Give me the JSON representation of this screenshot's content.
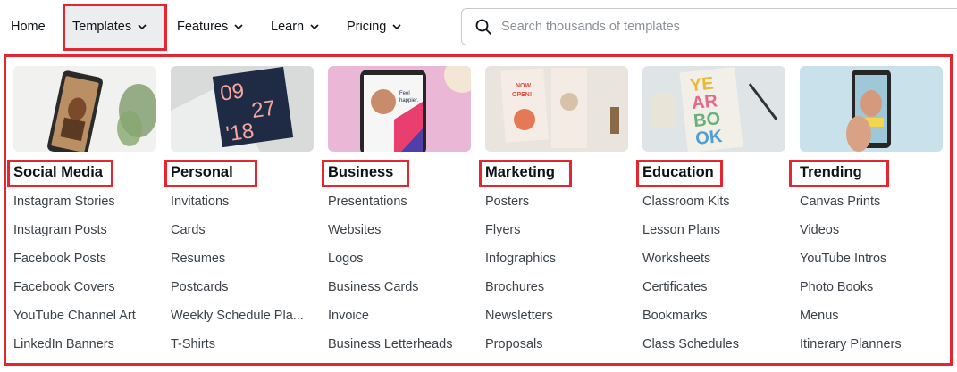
{
  "nav": {
    "items": [
      {
        "label": "Home",
        "has_chevron": false
      },
      {
        "label": "Templates",
        "has_chevron": true,
        "active": true
      },
      {
        "label": "Features",
        "has_chevron": true
      },
      {
        "label": "Learn",
        "has_chevron": true
      },
      {
        "label": "Pricing",
        "has_chevron": true
      }
    ],
    "search": {
      "placeholder": "Search thousands of templates",
      "icon": "search-icon"
    }
  },
  "colors": {
    "highlight": "#e3262f",
    "active_tab_bg": "#ecedef"
  },
  "menu": {
    "columns": [
      {
        "title": "Social Media",
        "thumbnail": "phone-instagram-story-image",
        "links": [
          "Instagram Stories",
          "Instagram Posts",
          "Facebook Posts",
          "Facebook Covers",
          "YouTube Channel Art",
          "LinkedIn Banners"
        ]
      },
      {
        "title": "Personal",
        "thumbnail": "invitation-card-image",
        "thumb_text": [
          "09",
          "27",
          "'18"
        ],
        "links": [
          "Invitations",
          "Cards",
          "Resumes",
          "Postcards",
          "Weekly Schedule Pla...",
          "T-Shirts"
        ]
      },
      {
        "title": "Business",
        "thumbnail": "business-phone-image",
        "thumb_text": [
          "Feel",
          "happier."
        ],
        "links": [
          "Presentations",
          "Websites",
          "Logos",
          "Business Cards",
          "Invoice",
          "Business Letterheads"
        ]
      },
      {
        "title": "Marketing",
        "thumbnail": "pizza-flyer-image",
        "thumb_text": [
          "NOW",
          "OPEN!"
        ],
        "links": [
          "Posters",
          "Flyers",
          "Infographics",
          "Brochures",
          "Newsletters",
          "Proposals"
        ]
      },
      {
        "title": "Education",
        "thumbnail": "yearbook-image",
        "thumb_text": [
          "YE",
          "AR",
          "BO",
          "OK"
        ],
        "links": [
          "Classroom Kits",
          "Lesson Plans",
          "Worksheets",
          "Certificates",
          "Bookmarks",
          "Class Schedules"
        ]
      },
      {
        "title": "Trending",
        "thumbnail": "hand-holding-phone-image",
        "links": [
          "Canvas Prints",
          "Videos",
          "YouTube Intros",
          "Photo Books",
          "Menus",
          "Itinerary Planners"
        ]
      }
    ]
  }
}
